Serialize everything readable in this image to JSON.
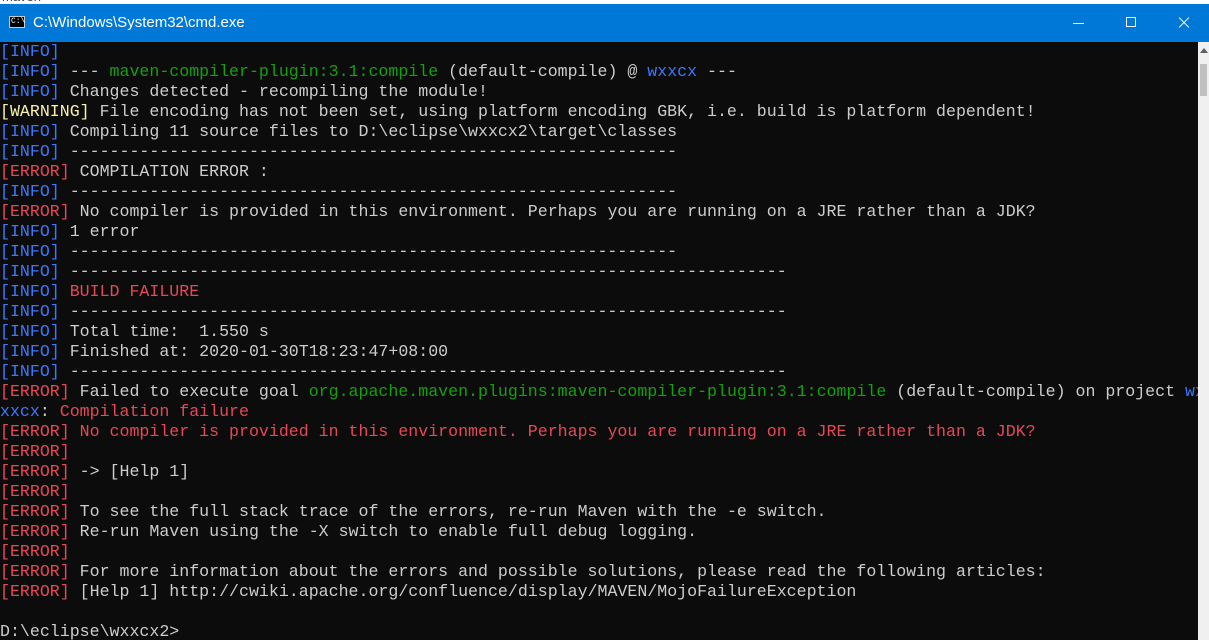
{
  "window": {
    "title": "C:\\Windows\\System32\\cmd.exe",
    "icon_text": "C:\\",
    "title_above": "maven"
  },
  "controls": {
    "minimize_icon": "minimize-icon",
    "maximize_icon": "maximize-icon",
    "close_icon": "close-icon"
  },
  "colors": {
    "titlebar": "#0078d7",
    "background": "#0c0c0c",
    "text": "#cccccc",
    "info": "#3b78ff",
    "warning": "#f9f1a5",
    "error": "#e74856",
    "green": "#13a10e"
  },
  "console": {
    "lines": [
      [
        [
          "[INFO]",
          "info"
        ]
      ],
      [
        [
          "[INFO]",
          "info"
        ],
        [
          " --- ",
          "norm"
        ],
        [
          "maven-compiler-plugin:3.1:compile",
          "green"
        ],
        [
          " (default-compile) @ ",
          "norm"
        ],
        [
          "wxxcx",
          "blue"
        ],
        [
          " ---",
          "norm"
        ]
      ],
      [
        [
          "[INFO]",
          "info"
        ],
        [
          " Changes detected - recompiling the module!",
          "norm"
        ]
      ],
      [
        [
          "[WARNING]",
          "warn"
        ],
        [
          " File encoding has not been set, using platform encoding GBK, i.e. build is platform dependent!",
          "norm"
        ]
      ],
      [
        [
          "[INFO]",
          "info"
        ],
        [
          " Compiling 11 source files to D:\\eclipse\\wxxcx2\\target\\classes",
          "norm"
        ]
      ],
      [
        [
          "[INFO]",
          "info"
        ],
        [
          " -------------------------------------------------------------",
          "norm"
        ]
      ],
      [
        [
          "[ERROR]",
          "err"
        ],
        [
          " COMPILATION ERROR :",
          "norm"
        ]
      ],
      [
        [
          "[INFO]",
          "info"
        ],
        [
          " -------------------------------------------------------------",
          "norm"
        ]
      ],
      [
        [
          "[ERROR]",
          "err"
        ],
        [
          " No compiler is provided in this environment. Perhaps you are running on a JRE rather than a JDK?",
          "norm"
        ]
      ],
      [
        [
          "[INFO]",
          "info"
        ],
        [
          " 1 error",
          "norm"
        ]
      ],
      [
        [
          "[INFO]",
          "info"
        ],
        [
          " -------------------------------------------------------------",
          "norm"
        ]
      ],
      [
        [
          "[INFO]",
          "info"
        ],
        [
          " ------------------------------------------------------------------------",
          "norm"
        ]
      ],
      [
        [
          "[INFO]",
          "info"
        ],
        [
          " BUILD FAILURE",
          "red"
        ]
      ],
      [
        [
          "[INFO]",
          "info"
        ],
        [
          " ------------------------------------------------------------------------",
          "norm"
        ]
      ],
      [
        [
          "[INFO]",
          "info"
        ],
        [
          " Total time:  1.550 s",
          "norm"
        ]
      ],
      [
        [
          "[INFO]",
          "info"
        ],
        [
          " Finished at: 2020-01-30T18:23:47+08:00",
          "norm"
        ]
      ],
      [
        [
          "[INFO]",
          "info"
        ],
        [
          " ------------------------------------------------------------------------",
          "norm"
        ]
      ],
      [
        [
          "[ERROR]",
          "err"
        ],
        [
          " Failed to execute goal ",
          "norm"
        ],
        [
          "org.apache.maven.plugins:maven-compiler-plugin:3.1:compile",
          "green"
        ],
        [
          " (default-compile) on project ",
          "norm"
        ],
        [
          "wx",
          "blue"
        ]
      ],
      [
        [
          "xxcx",
          "blue"
        ],
        [
          ": ",
          "norm"
        ],
        [
          "Compilation failure",
          "red"
        ]
      ],
      [
        [
          "[ERROR]",
          "err"
        ],
        [
          " No compiler is provided in this environment. Perhaps you are running on a JRE rather than a JDK?",
          "red"
        ]
      ],
      [
        [
          "[ERROR]",
          "err"
        ]
      ],
      [
        [
          "[ERROR]",
          "err"
        ],
        [
          " -> [Help 1]",
          "norm"
        ]
      ],
      [
        [
          "[ERROR]",
          "err"
        ]
      ],
      [
        [
          "[ERROR]",
          "err"
        ],
        [
          " To see the full stack trace of the errors, re-run Maven with the -e switch.",
          "norm"
        ]
      ],
      [
        [
          "[ERROR]",
          "err"
        ],
        [
          " Re-run Maven using the -X switch to enable full debug logging.",
          "norm"
        ]
      ],
      [
        [
          "[ERROR]",
          "err"
        ]
      ],
      [
        [
          "[ERROR]",
          "err"
        ],
        [
          " For more information about the errors and possible solutions, please read the following articles:",
          "norm"
        ]
      ],
      [
        [
          "[ERROR]",
          "err"
        ],
        [
          " [Help 1] http://cwiki.apache.org/confluence/display/MAVEN/MojoFailureException",
          "norm"
        ]
      ],
      [
        [
          "",
          "norm"
        ]
      ],
      [
        [
          "D:\\eclipse\\wxxcx2>",
          "norm"
        ]
      ]
    ]
  }
}
